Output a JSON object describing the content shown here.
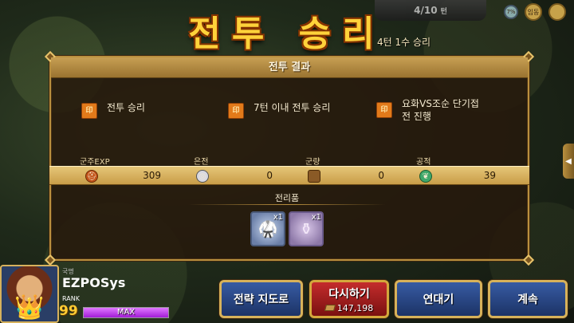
{
  "top": {
    "turn_counter": "4/10",
    "turn_unit": "턴",
    "icon1_label": "임동",
    "icon2_label": "7%"
  },
  "title": "전투 승리",
  "subtitle": "4턴 1수 승리",
  "panel": {
    "header": "전투 결과",
    "missions": [
      {
        "icon": "seal-icon",
        "label": "전투 승리"
      },
      {
        "icon": "seal-icon",
        "label": "7턴 이내 전투 승리"
      },
      {
        "icon": "seal-icon",
        "label_line1": "요화VS조순 단기접",
        "label_line2": "전 진행"
      }
    ],
    "stats": [
      {
        "label": "군주EXP",
        "icon": "exp-helmet-icon",
        "value": "309"
      },
      {
        "label": "은전",
        "icon": "silver-coin-icon",
        "value": "0"
      },
      {
        "label": "군량",
        "icon": "grain-sack-icon",
        "value": "0"
      },
      {
        "label": "공적",
        "icon": "jade-merit-icon",
        "value": "39"
      }
    ],
    "loot_title": "전리품",
    "loot": [
      {
        "icon": "armor-robe-icon",
        "qty": "x1"
      },
      {
        "icon": "gourd-vase-icon",
        "qty": "x1"
      }
    ]
  },
  "player": {
    "country_label": "국명",
    "name": "EZPOSys",
    "rank_label": "RANK",
    "rank": "99",
    "exp_text": "MAX",
    "exp_fill": 1.0
  },
  "buttons": {
    "strategy_map": "전략 지도로",
    "retry": "다시하기",
    "retry_cost": "147,198",
    "continuous": "연대기",
    "continue": "계속"
  },
  "colors": {
    "title": "#ffd23a",
    "panel_border": "#b98f3e",
    "stat_bar": "#d9b463",
    "button_blue": "#1c3366",
    "button_red": "#a81e1e",
    "exp_bar": "#b526e0"
  }
}
